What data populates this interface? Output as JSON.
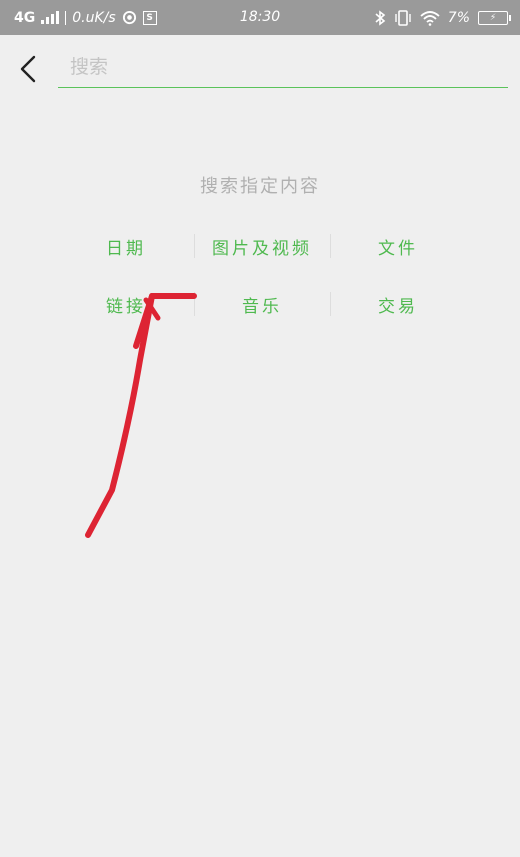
{
  "status_bar": {
    "network": "4G",
    "speed": "0.uK/s",
    "time": "18:30",
    "battery": "7%",
    "s_badge": "S"
  },
  "search": {
    "placeholder": "搜索",
    "value": ""
  },
  "section": {
    "title": "搜索指定内容",
    "items": [
      {
        "label": "日期"
      },
      {
        "label": "图片及视频"
      },
      {
        "label": "文件"
      },
      {
        "label": "链接"
      },
      {
        "label": "音乐"
      },
      {
        "label": "交易"
      }
    ]
  },
  "colors": {
    "accent": "#4fb94f",
    "annotation": "#dd2433",
    "status_bar_bg": "#9a9a9a",
    "page_bg": "#efefef"
  },
  "icons": {
    "back": "chevron-left-icon",
    "bluetooth": "bluetooth-icon",
    "vibrate": "vibrate-icon",
    "wifi": "wifi-icon",
    "battery": "battery-icon"
  }
}
